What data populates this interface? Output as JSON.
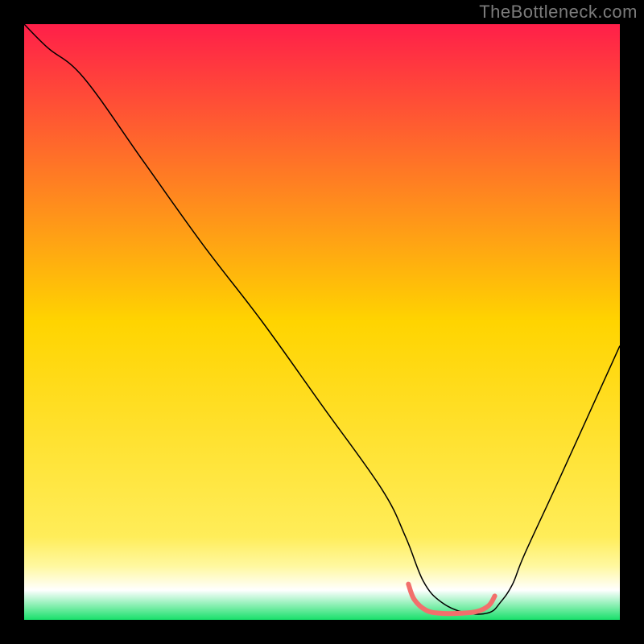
{
  "attribution": "TheBottleneck.com",
  "chart_data": {
    "type": "line",
    "title": "",
    "xlabel": "",
    "ylabel": "",
    "xlim": [
      0,
      100
    ],
    "ylim": [
      0,
      100
    ],
    "background_gradient": {
      "stops": [
        {
          "offset": 0,
          "color": "#ff1f49"
        },
        {
          "offset": 50,
          "color": "#ffd400"
        },
        {
          "offset": 86,
          "color": "#ffed59"
        },
        {
          "offset": 91,
          "color": "#fff8a0"
        },
        {
          "offset": 95,
          "color": "#ffffff"
        },
        {
          "offset": 100,
          "color": "#18e06a"
        }
      ]
    },
    "series": [
      {
        "name": "bottleneck-curve",
        "color": "#000000",
        "stroke_width": 1.5,
        "x": [
          0,
          4,
          10,
          20,
          30,
          40,
          50,
          60,
          64,
          67,
          70,
          74,
          78,
          80,
          82,
          84,
          90,
          100
        ],
        "y": [
          100,
          96,
          91,
          77,
          63,
          50,
          36,
          22,
          14,
          6.5,
          3,
          1.2,
          1.2,
          3,
          6,
          11,
          24,
          46
        ]
      },
      {
        "name": "optimal-band",
        "color": "#f26f6c",
        "stroke_width": 6,
        "linecap": "round",
        "x": [
          64.5,
          65.5,
          67.5,
          70,
          73,
          76,
          78,
          79
        ],
        "y": [
          6.0,
          3.4,
          1.6,
          1.1,
          1.1,
          1.4,
          2.4,
          4.0
        ]
      }
    ]
  }
}
